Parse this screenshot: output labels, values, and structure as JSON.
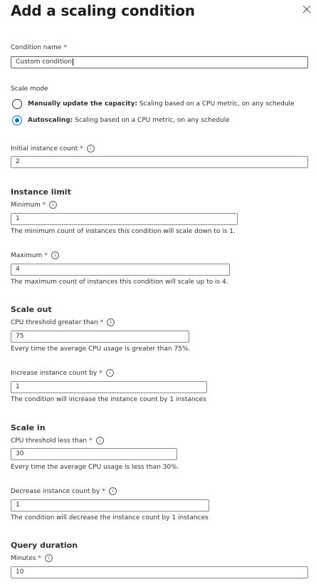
{
  "panel": {
    "title": "Add a scaling condition",
    "close_icon": "close-icon"
  },
  "condition_name": {
    "label": "Condition name",
    "required_mark": "*",
    "value": "Custom condition"
  },
  "scale_mode": {
    "label": "Scale mode",
    "options": [
      {
        "title": "Manually update the capacity:",
        "desc": " Scaling based on a CPU metric, on any schedule",
        "selected": false
      },
      {
        "title": "Autoscaling:",
        "desc": " Scaling based on a CPU metric, on any schedule",
        "selected": true
      }
    ]
  },
  "initial_instance_count": {
    "label": "Initial instance count",
    "required_mark": "*",
    "value": "2"
  },
  "instance_limit": {
    "heading": "Instance limit",
    "minimum": {
      "label": "Minimum",
      "required_mark": "*",
      "value": "1",
      "help": "The minimum count of instances this condition will scale down to is 1."
    },
    "maximum": {
      "label": "Maximum",
      "required_mark": "*",
      "value": "4",
      "help": "The maximum count of instances this condition will scale up to is 4."
    }
  },
  "scale_out": {
    "heading": "Scale out",
    "cpu_threshold": {
      "label": "CPU threshold greater than",
      "required_mark": "*",
      "value": "75",
      "help": "Every time the average CPU usage is greater than 75%."
    },
    "increase_count": {
      "label": "Increase instance count by",
      "required_mark": "*",
      "value": "1",
      "help": "The condition will increase the instance count by 1 instances"
    }
  },
  "scale_in": {
    "heading": "Scale in",
    "cpu_threshold": {
      "label": "CPU threshold less than",
      "required_mark": "*",
      "value": "30",
      "help": "Every time the average CPU usage is less than 30%."
    },
    "decrease_count": {
      "label": "Decrease instance count by",
      "required_mark": "*",
      "value": "1",
      "help": "The condition will decrease the instance count by 1 instances"
    }
  },
  "query_duration": {
    "heading": "Query duration",
    "minutes": {
      "label": "Minutes",
      "required_mark": "*",
      "value": "10"
    }
  },
  "info_icon_glyph": "i"
}
